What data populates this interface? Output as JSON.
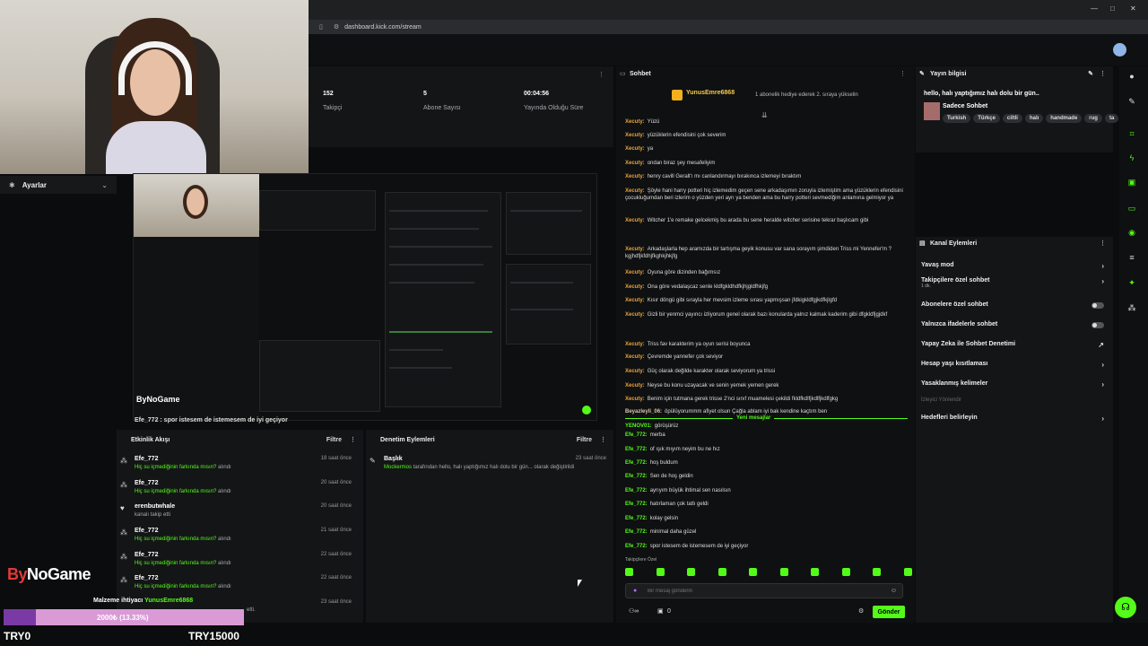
{
  "browser": {
    "url": "dashboard.kick.com/stream"
  },
  "stats": [
    {
      "num": "152",
      "label": "Takipçi"
    },
    {
      "num": "5",
      "label": "Abone Sayısı"
    },
    {
      "num": "00:04:56",
      "label": "Yayında Olduğu Süre"
    }
  ],
  "settings": {
    "label": "Ayarlar"
  },
  "nested": {
    "brand": "ByNoGame",
    "overlay_line": "Efe_772 : spor istesem de istemesem de iyi geçiyor"
  },
  "activity": {
    "title": "Etkinlik Akışı",
    "filter": "Filtre",
    "items": [
      {
        "user": "Efe_772",
        "msg": "Hiç su içmediğinin farkında mısın?",
        "suffix": "alındı",
        "time": "18 saat önce"
      },
      {
        "user": "Efe_772",
        "msg": "Hiç su içmediğinin farkında mısın?",
        "suffix": "alındı",
        "time": "20 saat önce"
      },
      {
        "user": "erenbutwhale",
        "msg": "kanalı takip etti",
        "suffix": "",
        "time": "20 saat önce"
      },
      {
        "user": "Efe_772",
        "msg": "Hiç su içmediğinin farkında mısın?",
        "suffix": "alındı",
        "time": "21 saat önce"
      },
      {
        "user": "Efe_772",
        "msg": "Hiç su içmediğinin farkında mısın?",
        "suffix": "alındı",
        "time": "22 saat önce"
      },
      {
        "user": "Efe_772",
        "msg": "Hiç su içmediğinin farkında mısın?",
        "suffix": "alındı",
        "time": "22 saat önce"
      }
    ],
    "last_time": "23 saat önce",
    "last_tail": "etti."
  },
  "audit": {
    "title": "Denetim Eylemleri",
    "filter": "Filtre",
    "entry_title": "Başlık",
    "entry_user": "Mockermos",
    "entry_text": "tarafından hello, halı yaptığımız halı dolu bir gün... olarak değiştirildi",
    "entry_time": "23 saat önce"
  },
  "chat": {
    "title": "Sohbet",
    "pinned_user": "YunusEmre6868",
    "pinned_text": "1 abonelik hediye ederek 2. sıraya yükselin",
    "messages": [
      {
        "user": "Xecuty:",
        "cls": "n-x",
        "text": "Yüzü"
      },
      {
        "user": "Xecuty:",
        "cls": "n-x",
        "text": "yüzüklerin efendisini çok severim"
      },
      {
        "user": "Xecuty:",
        "cls": "n-x",
        "text": "ya"
      },
      {
        "user": "Xecuty:",
        "cls": "n-x",
        "text": "ondan biraz şey mesafeliyim"
      },
      {
        "user": "Xecuty:",
        "cls": "n-x",
        "text": "henry cavill Geralt'ı mı canlandırmayı bırakınca izlemeyi bıraktım"
      },
      {
        "user": "Xecuty:",
        "cls": "n-x",
        "text": "Şöyle hani harry potteri hiç izlemedim geçen sene arkadaşımın zoruyla izlemiştim ama yüzüklerin efendisini çocukluğumdan beri izlerim o yüzden yeri ayrı ya benden ama bu harry potteri sevmediğim anlamına gelmiyor ya"
      },
      {
        "user": "Xecuty:",
        "cls": "n-x",
        "text": "Witcher 1'e remake gelcekmiş bu arada bu sene heralde witcher serisine tekrar başlıcam gibi"
      },
      {
        "user": "Xecuty:",
        "cls": "n-x",
        "text": "Arkadaşlarla hep aramızda bir tartışma geyik konusu var sana sorayım şimdiden Triss mi Yennefer'm ? kgjhdfjkfdhjfkghkjhkjfg"
      },
      {
        "user": "Xecuty:",
        "cls": "n-x",
        "text": "Oyuna göre dizinden bağımsız"
      },
      {
        "user": "Xecuty:",
        "cls": "n-x",
        "text": "Ona göre vedalaşcaz senle kldfgkldhdfkjhjgldfhkjfg"
      },
      {
        "user": "Xecuty:",
        "cls": "n-x",
        "text": "Kısır döngü gibi sırayla her mevsim izleme sırası yapmışsan jfdkigkldfgjkdfkjlgfd"
      },
      {
        "user": "Xecuty:",
        "cls": "n-x",
        "text": "Gizli bir yenmci yayıncı izliyorum genel olarak bazı konularda yalnız kalmak kaderim gibi dfgkldfjgjdkf"
      },
      {
        "user": "Xecuty:",
        "cls": "n-x",
        "text": "Triss fav karakterim ya oyun serisi boyunca"
      },
      {
        "user": "Xecuty:",
        "cls": "n-x",
        "text": "Çevremde yannefer çok seviyor"
      },
      {
        "user": "Xecuty:",
        "cls": "n-x",
        "text": "Güç olarak değilde karakter olarak seviyorum ya trissi"
      },
      {
        "user": "Xecuty:",
        "cls": "n-x",
        "text": "Neyse bu konu uzayacak ve senin yemek yemen gerek"
      },
      {
        "user": "Xecuty:",
        "cls": "n-x",
        "text": "Benim için tutmana gerek trisse 2'nci sınıf muamelesi çekildi fkldfkdlfjkdlfjkdlfgkg"
      },
      {
        "user": "Beyazleyli_06:",
        "cls": "n-b",
        "text": "öpülüyorummm afiyet olsun Çağla ablam iyi bak kendine kaçtım ben"
      },
      {
        "user": "YENOV01:",
        "cls": "n-y",
        "text": "görüşürüz"
      }
    ],
    "new_label": "Yeni mesajlar",
    "new_messages": [
      {
        "user": "Efe_772:",
        "cls": "n-e",
        "text": "merba"
      },
      {
        "user": "Efe_772:",
        "cls": "n-e",
        "text": "of ışık mıyım neyim bu ne hız"
      },
      {
        "user": "Efe_772:",
        "cls": "n-e",
        "text": "hoş buldum"
      },
      {
        "user": "Efe_772:",
        "cls": "n-e",
        "text": "Sen de hoş geldin"
      },
      {
        "user": "Efe_772:",
        "cls": "n-e",
        "text": "ayrıyım büyük ihtimal sen nasılsın"
      },
      {
        "user": "Efe_772:",
        "cls": "n-e",
        "text": "hatırlaman çok tatlı geldi"
      },
      {
        "user": "Efe_772:",
        "cls": "n-e",
        "text": "kolay gelsin"
      },
      {
        "user": "Efe_772:",
        "cls": "n-e",
        "text": "minimal daha güzel"
      },
      {
        "user": "Efe_772:",
        "cls": "n-e",
        "text": "spor istesem de istemesem de iyi geçiyor"
      }
    ],
    "followers_only": "Takipçilere Özel",
    "input_placeholder": "Bir mesaj gönderin",
    "count": "0",
    "send": "Gönder"
  },
  "stream_info": {
    "title": "Yayın bilgisi",
    "stream_title": "hello, halı yaptığımız halı dolu bir gün..",
    "category": "Sadece Sohbet",
    "tags": [
      "Turkish",
      "Türkçe",
      "ciltli",
      "halı",
      "handmade",
      "rug",
      "ta"
    ]
  },
  "channel_actions": {
    "title": "Kanal Eylemleri",
    "items": [
      {
        "label": "Yavaş mod",
        "sub": "",
        "kind": "arrow"
      },
      {
        "label": "Takipçilere özel sohbet",
        "sub": "1 dk.",
        "kind": "arrow"
      },
      {
        "label": "Abonelere özel sohbet",
        "sub": "",
        "kind": "toggle"
      },
      {
        "label": "Yalnızca ifadelerle sohbet",
        "sub": "",
        "kind": "toggle"
      },
      {
        "label": "Yapay Zeka ile Sohbet Denetimi",
        "sub": "",
        "kind": "ext"
      },
      {
        "label": "Hesap yaşı kısıtlaması",
        "sub": "",
        "kind": "arrow"
      },
      {
        "label": "Yasaklanmış kelimeler",
        "sub": "",
        "kind": "arrow"
      },
      {
        "label": "İzleyici Yönlendir",
        "sub": "",
        "kind": "none"
      },
      {
        "label": "Hedefleri belirleyin",
        "sub": "",
        "kind": "arrow"
      }
    ]
  },
  "overlay": {
    "brand_k": "By",
    "brand_rest": "NoGame",
    "goal_title": "Malzeme ihtiyacı",
    "goal_user": "YunusEmre6868",
    "goal_text": "2000₺ (13.33%)",
    "goal_progress": 0.1333,
    "goal_min": "TRY0",
    "goal_max": "TRY15000"
  },
  "colors": {
    "accent": "#53fc18",
    "goal_fill": "#7a3aa5",
    "goal_bg": "#d99ad6"
  }
}
